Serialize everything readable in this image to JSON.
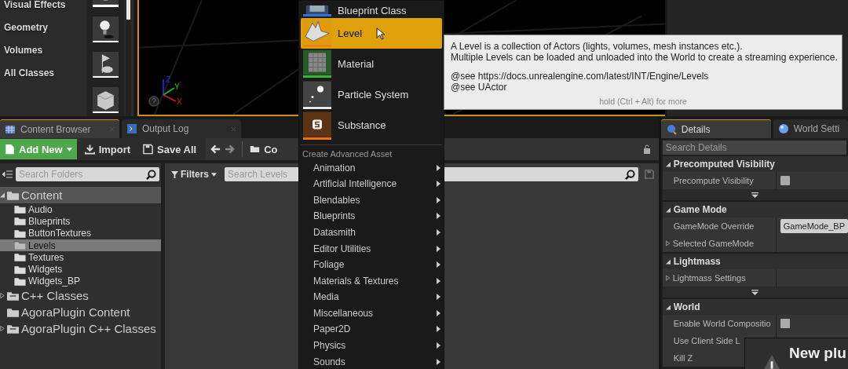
{
  "place_actors": {
    "categories": [
      "Visual Effects",
      "Geometry",
      "Volumes",
      "All Classes"
    ]
  },
  "viewport": {
    "axes": {
      "x": "X",
      "y": "Y",
      "z": "Z"
    }
  },
  "content_browser": {
    "tabs": [
      {
        "label": "Content Browser",
        "selected": true
      },
      {
        "label": "Output Log",
        "selected": false
      }
    ],
    "toolbar": {
      "add_new": "Add New",
      "import": "Import",
      "save_all": "Save All",
      "path": "Co"
    },
    "folder_search": {
      "placeholder": "Search Folders"
    },
    "filters": "Filters",
    "asset_search": {
      "placeholder": "Search Levels"
    },
    "tree": [
      {
        "label": "Content",
        "kind": "root",
        "has_children": true,
        "expanded": true,
        "selected": false,
        "children": [
          {
            "label": "Audio",
            "selected": false
          },
          {
            "label": "Blueprints",
            "selected": false
          },
          {
            "label": "ButtonTextures",
            "selected": false
          },
          {
            "label": "Levels",
            "selected": true
          },
          {
            "label": "Textures",
            "selected": false
          },
          {
            "label": "Widgets",
            "selected": false
          },
          {
            "label": "Widgets_BP",
            "selected": false
          }
        ]
      },
      {
        "label": "C++ Classes",
        "kind": "code",
        "has_children": true,
        "expanded": false,
        "selected": false
      },
      {
        "label": "AgoraPlugin Content",
        "kind": "folder",
        "has_children": false,
        "selected": false
      },
      {
        "label": "AgoraPlugin C++ Classes",
        "kind": "code",
        "has_children": true,
        "expanded": false,
        "selected": false
      }
    ]
  },
  "new_asset_menu": {
    "items": [
      {
        "label": "Blueprint Class",
        "kind": "blueprint",
        "color": "#2f6fe0",
        "selected": false
      },
      {
        "label": "Level",
        "kind": "level",
        "color": "#f08010",
        "selected": true
      },
      {
        "label": "Material",
        "kind": "material",
        "color": "#3cb43c",
        "selected": false
      },
      {
        "label": "Particle System",
        "kind": "particle",
        "color": "#e8e8e8",
        "selected": false
      },
      {
        "label": "Substance",
        "kind": "substance",
        "color": "#f07010",
        "selected": false
      }
    ],
    "section": "Create Advanced Asset",
    "submenus": [
      "Animation",
      "Artificial Intelligence",
      "Blendables",
      "Blueprints",
      "Datasmith",
      "Editor Utilities",
      "Foliage",
      "Materials & Textures",
      "Media",
      "Miscellaneous",
      "Paper2D",
      "Physics",
      "Sounds"
    ]
  },
  "tooltip": {
    "lines": [
      "A Level is a collection of Actors (lights, volumes, mesh instances etc.).",
      "Multiple Levels can be loaded and unloaded into the World to create a streaming experience."
    ],
    "see": [
      "@see https://docs.unrealengine.com/latest/INT/Engine/Levels",
      "@see UActor"
    ],
    "hint": "hold (Ctrl + Alt) for more"
  },
  "details": {
    "tabs": [
      {
        "label": "Details",
        "selected": true
      },
      {
        "label": "World Setti",
        "selected": false
      }
    ],
    "search": {
      "placeholder": "Search Details"
    },
    "sections": [
      {
        "title": "Precomputed Visibility",
        "advanced": true,
        "rows": [
          {
            "label": "Precompute Visibility",
            "kind": "checkbox",
            "checked": false
          }
        ]
      },
      {
        "title": "Game Mode",
        "advanced": false,
        "rows": [
          {
            "label": "GameMode Override",
            "kind": "value",
            "value": "GameMode_BP"
          },
          {
            "label": "Selected GameMode",
            "kind": "group"
          }
        ]
      },
      {
        "title": "Lightmass",
        "advanced": true,
        "rows": [
          {
            "label": "Lightmass Settings",
            "kind": "group"
          }
        ]
      },
      {
        "title": "World",
        "advanced": false,
        "rows": [
          {
            "label": "Enable World Compositio",
            "kind": "checkbox",
            "checked": false
          },
          {
            "label": "Use Client Side L",
            "kind": "plain"
          },
          {
            "label": "Kill Z",
            "kind": "plain"
          }
        ]
      }
    ]
  },
  "notification": {
    "title": "New plu"
  }
}
